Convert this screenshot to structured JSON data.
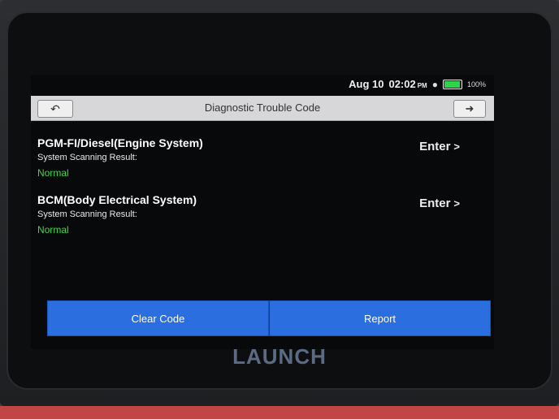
{
  "status": {
    "date": "Aug 10",
    "time": "02:02",
    "ampm": "PM",
    "battery_pct_label": "100%",
    "battery_level": 1.0
  },
  "header": {
    "title": "Diagnostic Trouble Code",
    "back_icon": "back-arrow-icon",
    "exit_icon": "exit-icon"
  },
  "systems": [
    {
      "name": "PGM-FI/Diesel(Engine System)",
      "label": "System Scanning Result:",
      "result": "Normal",
      "action": "Enter"
    },
    {
      "name": "BCM(Body Electrical System)",
      "label": "System Scanning Result:",
      "result": "Normal",
      "action": "Enter"
    }
  ],
  "actions": {
    "clear_label": "Clear Code",
    "report_label": "Report"
  },
  "brand": {
    "logo_text": "LAUNCH"
  },
  "colors": {
    "accent_blue": "#2b6ee0",
    "result_green": "#3edb47",
    "titlebar": "#d7d7da"
  }
}
